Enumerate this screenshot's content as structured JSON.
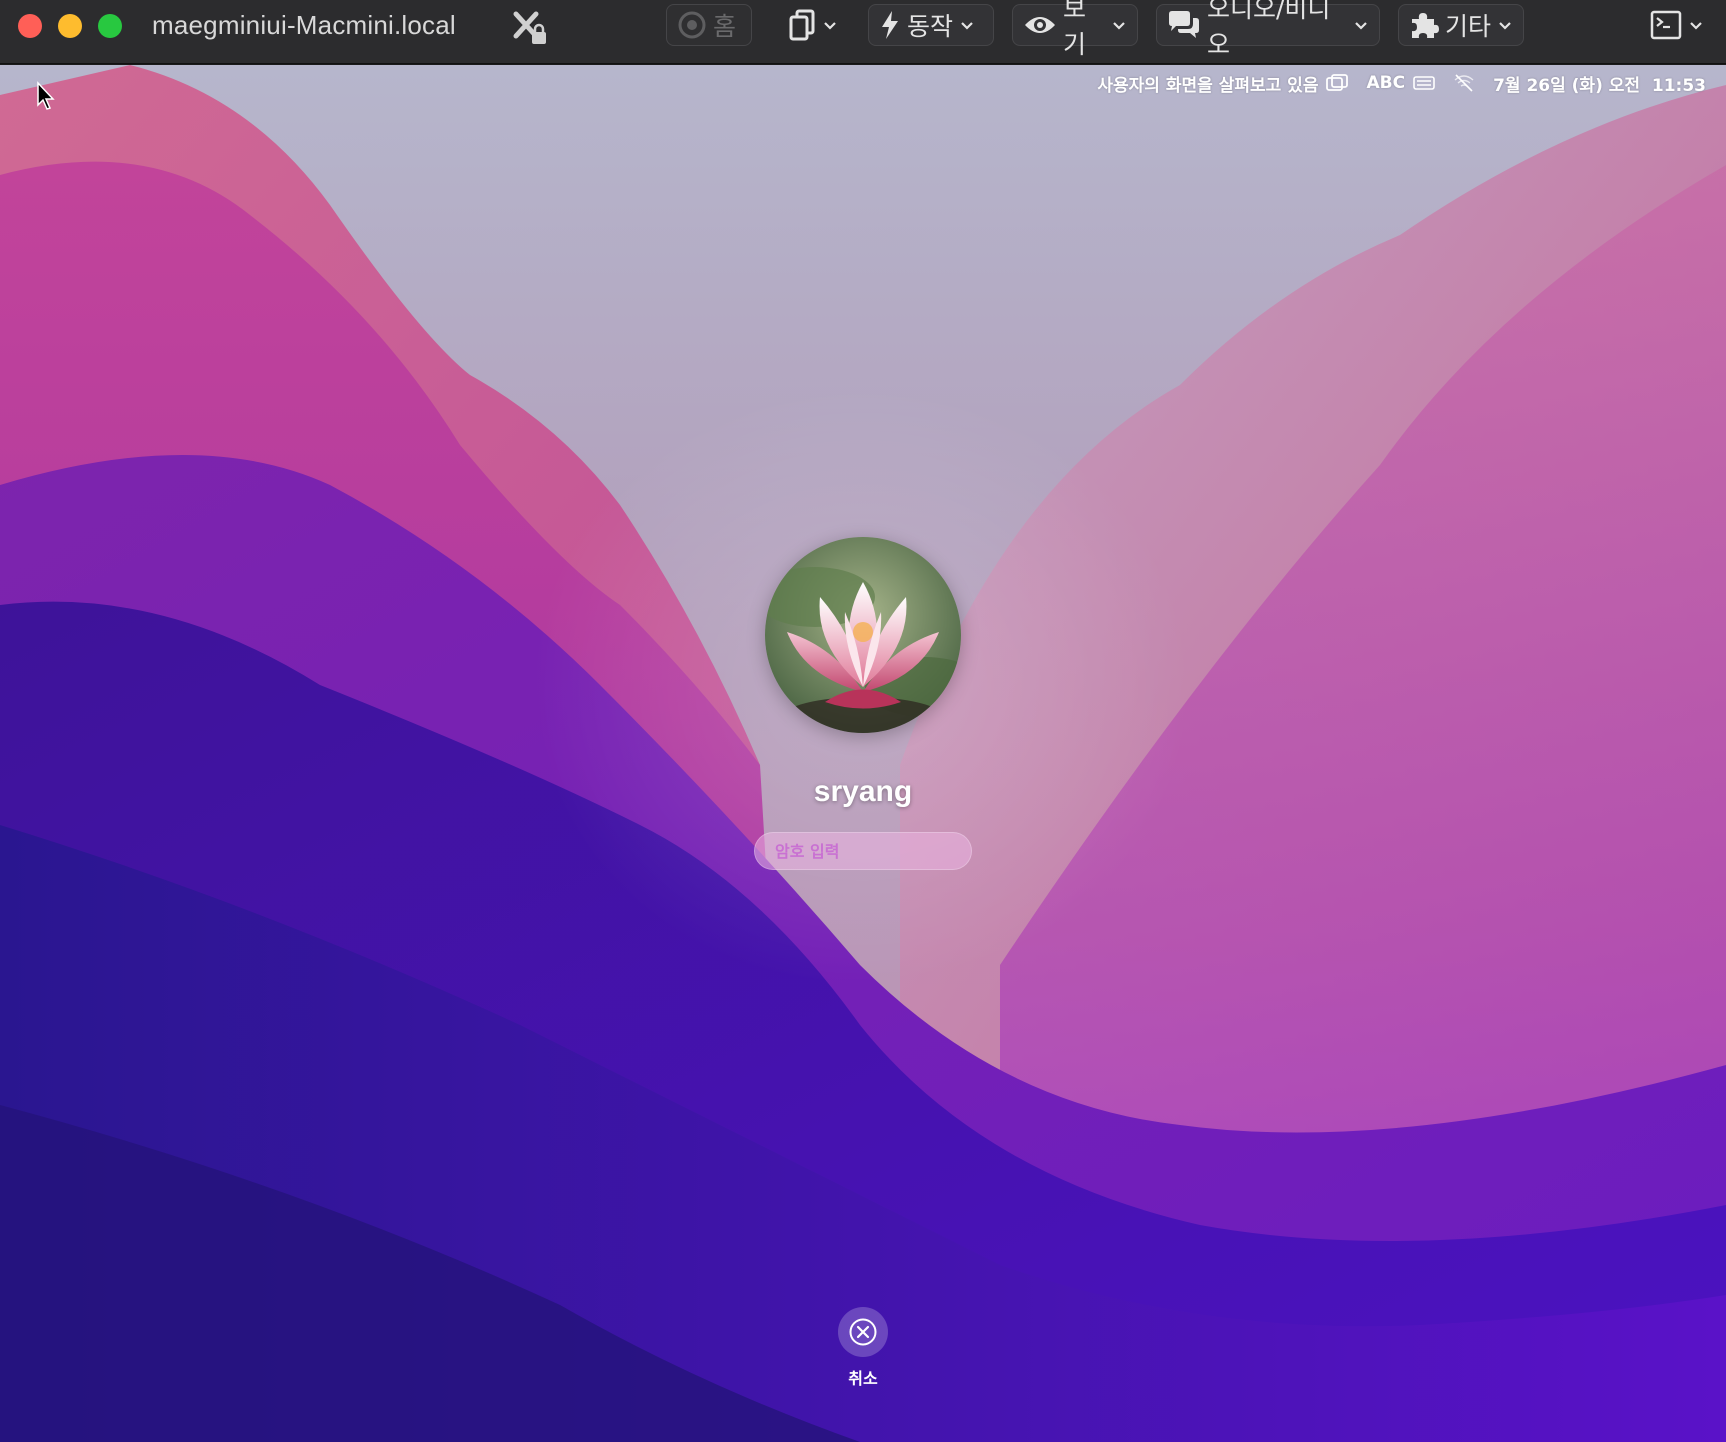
{
  "window": {
    "title": "maegminiui-Macmini.local",
    "traffic_colors": {
      "close": "#ff5f57",
      "minimize": "#febc2e",
      "maximize": "#28c840"
    }
  },
  "toolbar": {
    "home_label": "홈",
    "actions_label": "동작",
    "view_label": "보기",
    "audio_video_label": "오디오/비디오",
    "more_label": "기타"
  },
  "menubar": {
    "screen_sharing_status": "사용자의 화면을 살펴보고 있음",
    "input_source": "ABC",
    "datetime": "7월 26일 (화) 오전  11:53"
  },
  "login": {
    "username": "sryang",
    "password_placeholder": "암호 입력",
    "cancel_label": "취소"
  },
  "colors": {
    "accent_purple": "#5a12c8",
    "wallpaper_pink": "#c0468c"
  }
}
